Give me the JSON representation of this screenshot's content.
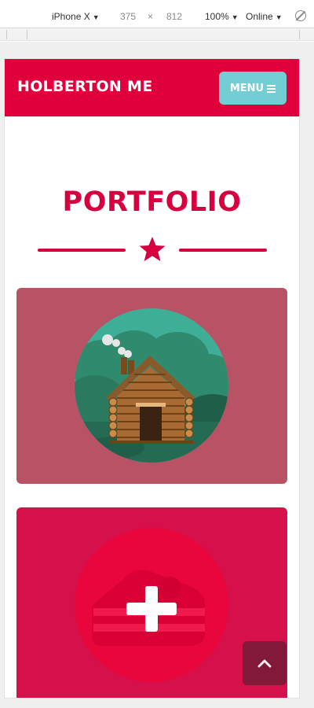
{
  "devtools": {
    "device": "iPhone X",
    "width": "375",
    "times": "×",
    "height": "812",
    "zoom": "100%",
    "network": "Online"
  },
  "navbar": {
    "brand": "HOLBERTON ME",
    "menu_label": "MENU"
  },
  "portfolio": {
    "title": "PORTFOLIO",
    "items": [
      {
        "icon": "log-cabin",
        "bg_color": "#b85365"
      },
      {
        "icon": "cake-hover-plus",
        "bg_color": "#d5104a"
      }
    ]
  },
  "colors": {
    "primary": "#e0003c",
    "title": "#d6003e",
    "menu_button": "#72cdd4",
    "scroll_button": "#7b1a37"
  }
}
